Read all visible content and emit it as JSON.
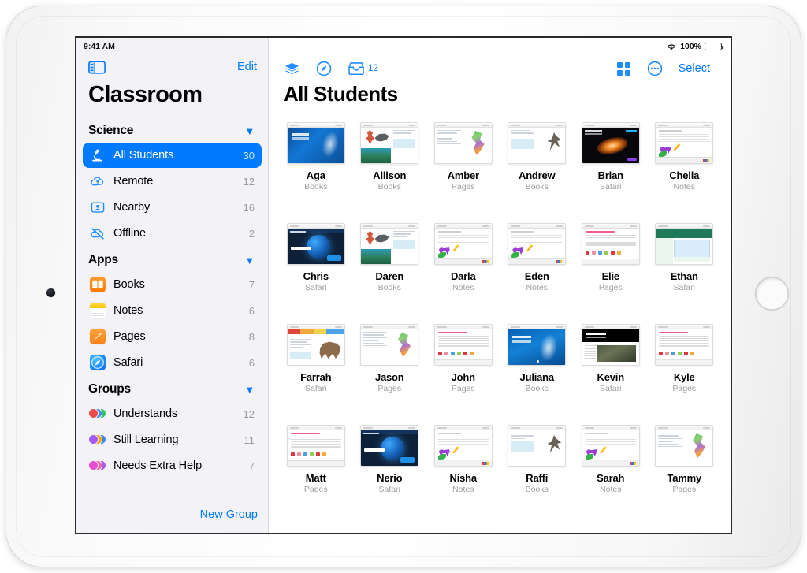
{
  "status_bar": {
    "time": "9:41 AM",
    "battery_percent": "100%",
    "wifi_icon": "wifi-icon",
    "battery_icon": "battery-full-icon"
  },
  "sidebar": {
    "toggle_icon": "sidebar-toggle-icon",
    "edit_label": "Edit",
    "app_title": "Classroom",
    "new_group_label": "New Group",
    "sections": [
      {
        "title": "Science",
        "collapse_icon": "chevron-down-icon",
        "items": [
          {
            "label": "All Students",
            "count": "30",
            "icon": "microscope-icon",
            "selected": true
          },
          {
            "label": "Remote",
            "count": "12",
            "icon": "cloud-person-icon",
            "selected": false
          },
          {
            "label": "Nearby",
            "count": "16",
            "icon": "person-rectangle-icon",
            "selected": false
          },
          {
            "label": "Offline",
            "count": "2",
            "icon": "cloud-slash-icon",
            "selected": false
          }
        ]
      },
      {
        "title": "Apps",
        "collapse_icon": "chevron-down-icon",
        "items": [
          {
            "label": "Books",
            "count": "7",
            "icon": "books-app-icon",
            "selected": false
          },
          {
            "label": "Notes",
            "count": "6",
            "icon": "notes-app-icon",
            "selected": false
          },
          {
            "label": "Pages",
            "count": "8",
            "icon": "pages-app-icon",
            "selected": false
          },
          {
            "label": "Safari",
            "count": "6",
            "icon": "safari-app-icon",
            "selected": false
          }
        ]
      },
      {
        "title": "Groups",
        "collapse_icon": "chevron-down-icon",
        "items": [
          {
            "label": "Understands",
            "count": "12",
            "icon": "group-avatars-icon",
            "selected": false,
            "colors": [
              "#ef4b4b",
              "#3f8bf0",
              "#34c759"
            ]
          },
          {
            "label": "Still Learning",
            "count": "11",
            "icon": "group-avatars-icon",
            "selected": false,
            "colors": [
              "#a55cf0",
              "#ff9f0a",
              "#3f8bf0"
            ]
          },
          {
            "label": "Needs Extra Help",
            "count": "7",
            "icon": "group-avatars-icon",
            "selected": false,
            "colors": [
              "#e84bd4",
              "#ff6392",
              "#a55cf0"
            ]
          }
        ]
      }
    ]
  },
  "main": {
    "page_title": "All Students",
    "toolbar": {
      "layers_icon": "layers-icon",
      "safari_icon": "safari-compass-icon",
      "inbox_icon": "inbox-tray-icon",
      "inbox_count": "12",
      "grid_view_icon": "grid-view-icon",
      "more_icon": "ellipsis-circle-icon",
      "select_label": "Select"
    },
    "students": [
      {
        "name": "Aga",
        "app": "Books",
        "art": "art-ocean"
      },
      {
        "name": "Allison",
        "app": "Books",
        "art": "art-coral"
      },
      {
        "name": "Amber",
        "app": "Pages",
        "art": "art-map"
      },
      {
        "name": "Andrew",
        "app": "Books",
        "art": "art-bookpage"
      },
      {
        "name": "Brian",
        "app": "Safari",
        "art": "art-space"
      },
      {
        "name": "Chella",
        "app": "Notes",
        "art": "art-notes"
      },
      {
        "name": "Chris",
        "app": "Safari",
        "art": "art-darknet"
      },
      {
        "name": "Daren",
        "app": "Books",
        "art": "art-coral"
      },
      {
        "name": "Darla",
        "app": "Notes",
        "art": "art-notes"
      },
      {
        "name": "Eden",
        "app": "Notes",
        "art": "art-notes"
      },
      {
        "name": "Elie",
        "app": "Pages",
        "art": "art-pink"
      },
      {
        "name": "Ethan",
        "app": "Safari",
        "art": "art-green"
      },
      {
        "name": "Farrah",
        "app": "Safari",
        "art": "art-mammoth"
      },
      {
        "name": "Jason",
        "app": "Pages",
        "art": "art-map"
      },
      {
        "name": "John",
        "app": "Pages",
        "art": "art-pink"
      },
      {
        "name": "Juliana",
        "app": "Books",
        "art": "art-ocean2"
      },
      {
        "name": "Kevin",
        "app": "Safari",
        "art": "art-shakes"
      },
      {
        "name": "Kyle",
        "app": "Pages",
        "art": "art-pink"
      },
      {
        "name": "Matt",
        "app": "Pages",
        "art": "art-pink"
      },
      {
        "name": "Nerio",
        "app": "Safari",
        "art": "art-darknet"
      },
      {
        "name": "Nisha",
        "app": "Notes",
        "art": "art-notes"
      },
      {
        "name": "Raffi",
        "app": "Books",
        "art": "art-bookpage"
      },
      {
        "name": "Sarah",
        "app": "Notes",
        "art": "art-notes"
      },
      {
        "name": "Tammy",
        "app": "Pages",
        "art": "art-map"
      }
    ]
  },
  "theme": {
    "accent": "#007aff",
    "sidebar_bg": "#f2f2f7",
    "selected_bg": "#007aff",
    "count_color": "#9a9aa0"
  }
}
